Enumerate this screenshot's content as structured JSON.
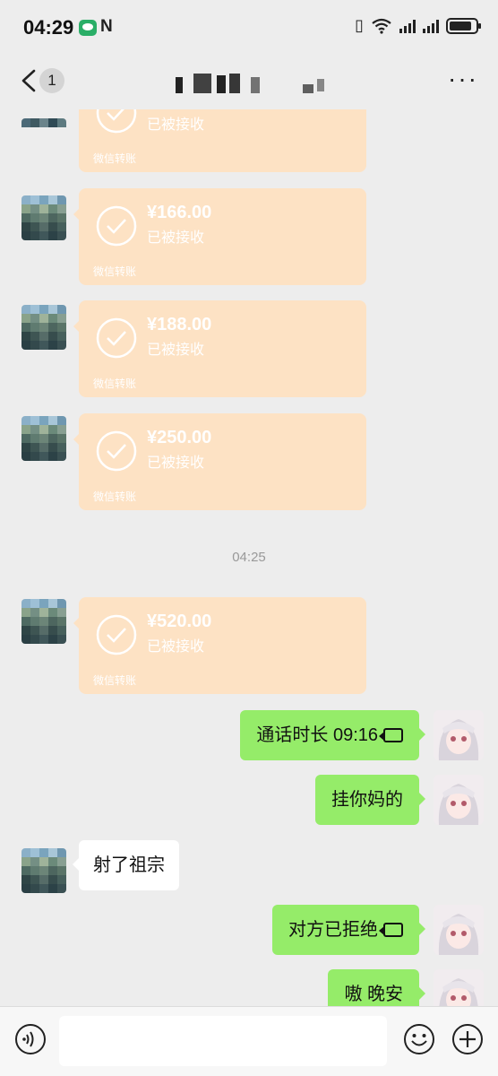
{
  "status_bar": {
    "time": "04:29",
    "nfc_label": "N",
    "wifi_icon": "wifi-icon",
    "battery_icon": "battery-icon"
  },
  "nav": {
    "back_icon": "chevron-left-icon",
    "unread_badge": "1",
    "title_obscured": true,
    "more_icon": "more-dots-icon"
  },
  "messages": {
    "transfers": [
      {
        "amount": "",
        "status": "已被接收",
        "footer": "微信转账"
      },
      {
        "amount": "¥166.00",
        "status": "已被接收",
        "footer": "微信转账"
      },
      {
        "amount": "¥188.00",
        "status": "已被接收",
        "footer": "微信转账"
      },
      {
        "amount": "¥250.00",
        "status": "已被接收",
        "footer": "微信转账"
      },
      {
        "amount": "¥520.00",
        "status": "已被接收",
        "footer": "微信转账"
      }
    ],
    "time_separator": "04:25",
    "call_duration": "通话时长 09:16",
    "sent_1": "挂你妈的",
    "received_1": "射了祖宗",
    "call_rejected": "对方已拒绝",
    "sent_2": "嗷 晚安"
  },
  "input_bar": {
    "voice_icon": "voice-icon",
    "placeholder": "",
    "emoji_icon": "emoji-icon",
    "plus_icon": "plus-icon"
  },
  "colors": {
    "background": "#ededed",
    "transfer_card": "#fde2c4",
    "sent_bubble": "#95ec69",
    "received_bubble": "#ffffff"
  }
}
